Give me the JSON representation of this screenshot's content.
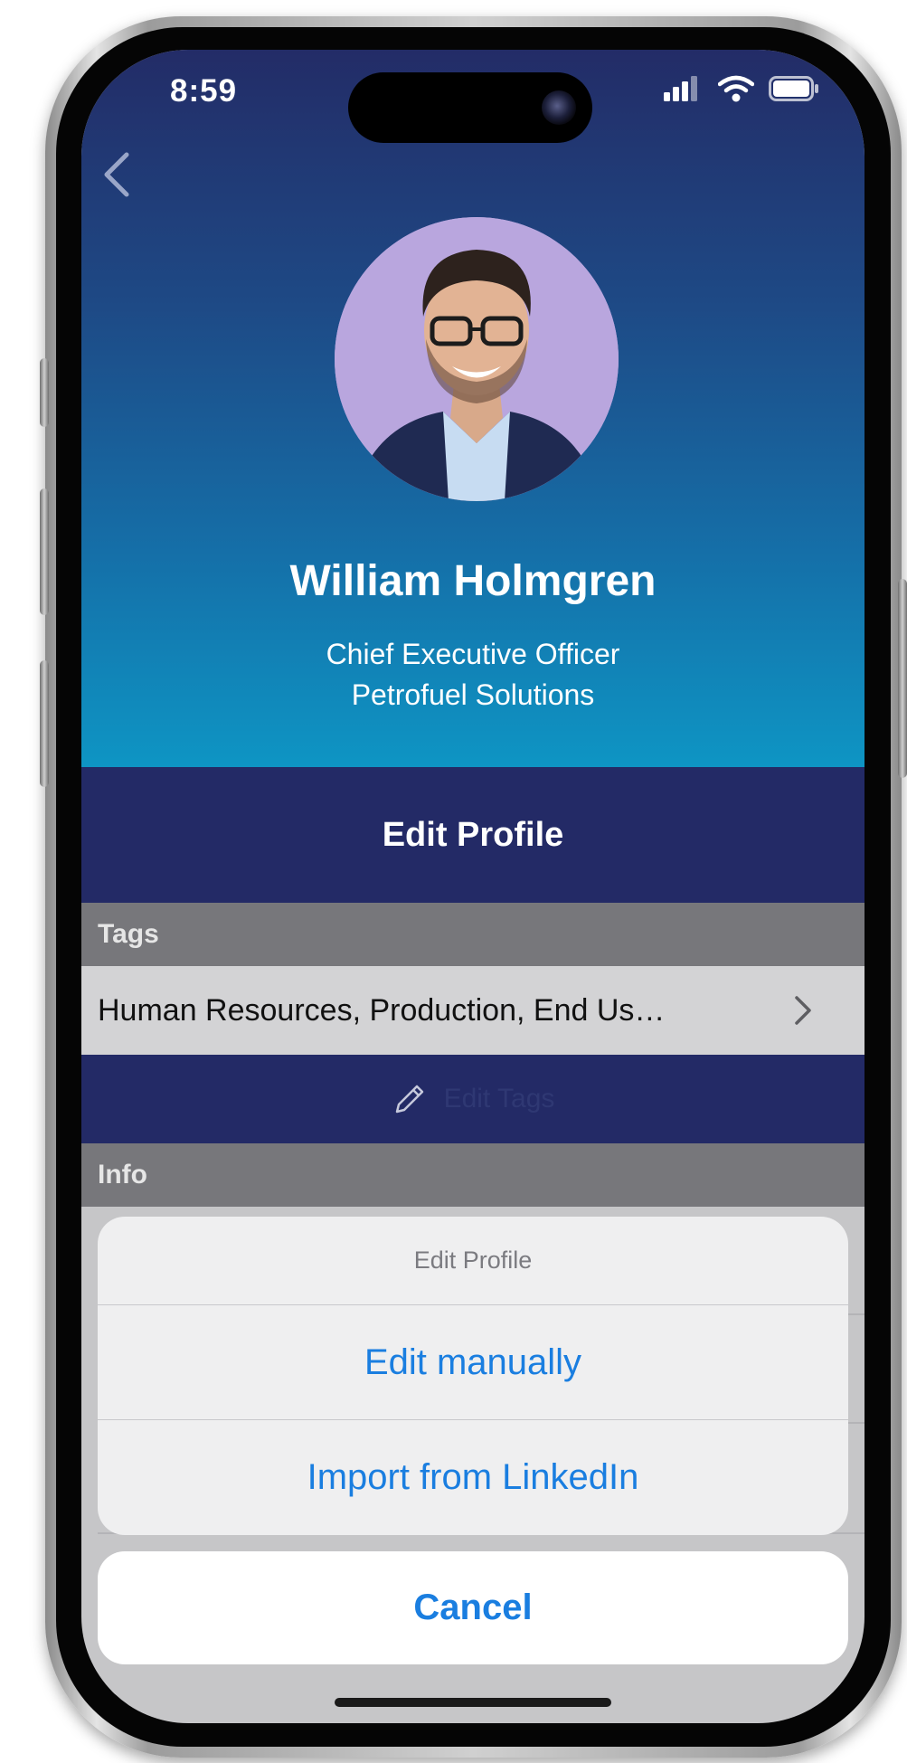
{
  "status_bar": {
    "time": "8:59",
    "signal_icon": "cellular-signal-icon",
    "wifi_icon": "wifi-icon",
    "battery_icon": "battery-icon"
  },
  "navigation": {
    "back_icon": "chevron-left-icon"
  },
  "profile": {
    "avatar_icon": "profile-photo",
    "name": "William Holmgren",
    "title": "Chief Executive Officer",
    "company": "Petrofuel Solutions"
  },
  "actions": {
    "edit_profile_label": "Edit Profile"
  },
  "tags": {
    "header": "Tags",
    "value": "Human Resources, Production, End Us…",
    "chevron_icon": "chevron-right-icon",
    "edit_icon": "pencil-icon",
    "edit_label": "Edit Tags"
  },
  "info": {
    "header": "Info"
  },
  "action_sheet": {
    "title": "Edit Profile",
    "options": [
      {
        "label": "Edit manually"
      },
      {
        "label": "Import from LinkedIn"
      }
    ],
    "cancel_label": "Cancel"
  },
  "colors": {
    "header_top": "#232c67",
    "header_bottom": "#0e95c4",
    "bar_navy": "#232a66",
    "section_gray": "#77777b",
    "ios_blue": "#1a7ee0"
  }
}
